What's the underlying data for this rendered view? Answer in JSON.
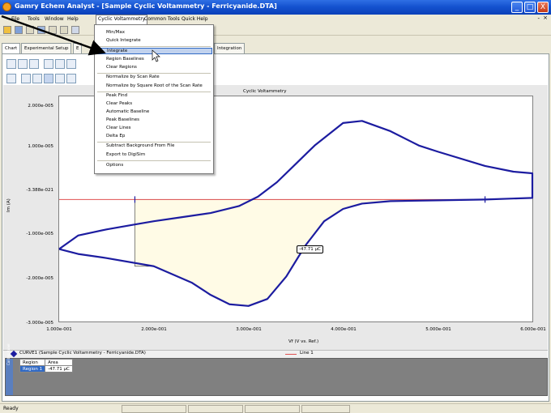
{
  "window": {
    "title": "Gamry Echem Analyst - [Sample Cyclic Voltammetry - Ferricyanide.DTA]",
    "buttons": [
      "_",
      "□",
      "X"
    ]
  },
  "menubar": {
    "items": [
      "File",
      "Tools",
      "Window",
      "Help",
      "Cyclic Voltammetry",
      "Common Tools",
      "Quick Help"
    ],
    "mdi_min": "- ",
    "mdi_close": "×"
  },
  "tabs": [
    "Chart",
    "Experimental Setup",
    "E",
    "Integration"
  ],
  "dropdown": {
    "items": [
      "Min/Max",
      "Quick Integrate",
      "Integrate",
      "Region Baselines",
      "Clear Regions",
      "Normalize by Scan Rate",
      "Normalize by Square Root of the Scan Rate",
      "Peak Find",
      "Clear Peaks",
      "Automatic Baseline",
      "Peak Baselines",
      "Clear Lines",
      "Delta Ep",
      "Subtract Background From File",
      "Export to DigiSim",
      "Options"
    ]
  },
  "chart": {
    "title": "Cyclic Voltammetry",
    "xlabel": "Vf (V vs. Ref.)",
    "ylabel": "Im (A)",
    "area_label": "-47.71 µC"
  },
  "chart_data": {
    "type": "line",
    "title": "Cyclic Voltammetry",
    "xlabel": "Vf (V vs. Ref.)",
    "ylabel": "Im (A)",
    "xlim": [
      0.1,
      0.6
    ],
    "ylim": [
      -3e-05,
      2.5e-05
    ],
    "xticks": [
      "1.000e-001",
      "2.000e-001",
      "3.000e-001",
      "4.000e-001",
      "5.000e-001",
      "6.000e-001"
    ],
    "yticks": [
      "2.000e-005",
      "1.000e-005",
      "-3.388e-021",
      "-1.000e-005",
      "-2.000e-005",
      "-3.000e-005"
    ],
    "series": [
      {
        "name": "CURVE1 (Sample Cyclic Voltammetry - Ferricyanide.DTA)",
        "x": [
          0.1,
          0.12,
          0.15,
          0.18,
          0.2,
          0.23,
          0.26,
          0.29,
          0.31,
          0.33,
          0.35,
          0.37,
          0.4,
          0.42,
          0.45,
          0.48,
          0.5,
          0.55,
          0.58,
          0.6,
          0.6,
          0.55,
          0.5,
          0.45,
          0.42,
          0.4,
          0.38,
          0.36,
          0.34,
          0.32,
          0.3,
          0.28,
          0.26,
          0.24,
          0.2,
          0.15,
          0.12,
          0.1
        ],
        "y": [
          -1.23e-05,
          -9e-06,
          -7.5e-06,
          -6.3e-06,
          -5.5e-06,
          -4.5e-06,
          -3.5e-06,
          -1.8e-06,
          5e-07,
          4e-06,
          8.5e-06,
          1.3e-05,
          1.85e-05,
          1.9e-05,
          1.65e-05,
          1.3e-05,
          1.15e-05,
          8e-06,
          6.6e-06,
          6.2e-06,
          2e-07,
          -2e-07,
          -4e-07,
          -6e-07,
          -1.2e-06,
          -2.5e-06,
          -5.5e-06,
          -1.15e-05,
          -1.9e-05,
          -2.45e-05,
          -2.62e-05,
          -2.58e-05,
          -2.35e-05,
          -2.05e-05,
          -1.65e-05,
          -1.45e-05,
          -1.35e-05,
          -1.23e-05
        ]
      },
      {
        "name": "Line 1",
        "x": [
          0.1,
          0.18,
          0.18,
          0.55,
          0.6
        ],
        "y": [
          -2e-07,
          -2e-07,
          -2e-07,
          -2e-07,
          2e-07
        ]
      }
    ],
    "integration_region": {
      "x_start": 0.18,
      "x_end": 0.55,
      "charge": "-47.71 µC"
    },
    "legend": [
      "CURVE1 (Sample Cyclic Voltammetry - Ferricyanide.DTA)",
      "Line 1"
    ],
    "grid": false
  },
  "legend": {
    "curve1": "CURVE1 (Sample Cyclic Voltammetry - Ferricyanide.DTA)",
    "line1": "Line 1"
  },
  "results": {
    "headers": [
      "Region",
      "Area"
    ],
    "rows": [
      [
        "Region 1",
        "-47.71 µC"
      ]
    ]
  },
  "side_strip_label": "Control Panel",
  "status": {
    "text": "Ready"
  },
  "colors": {
    "curve": "#1c1ca0",
    "baseline": "#e05050",
    "region_fill": "#fffbe6",
    "highlight": "#c1d2ee"
  }
}
